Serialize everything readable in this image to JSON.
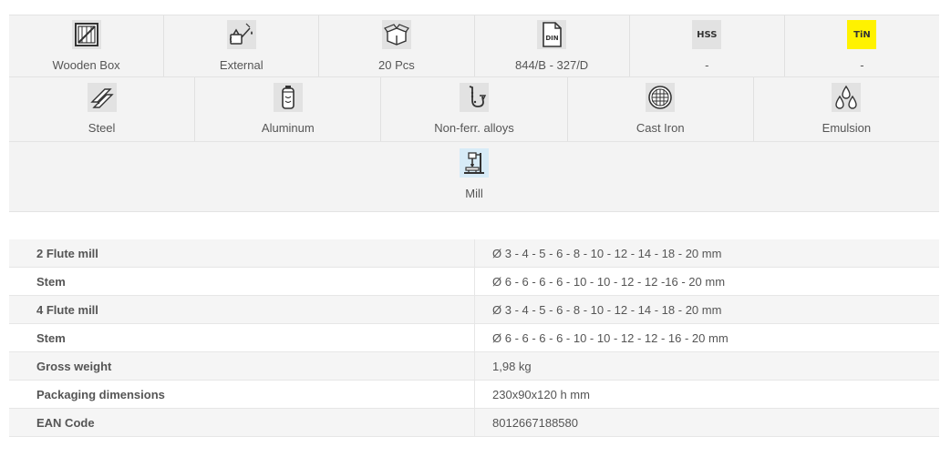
{
  "row1": [
    {
      "icon": "wooden-box-icon",
      "label": "Wooden Box"
    },
    {
      "icon": "oil-can-icon",
      "label": "External"
    },
    {
      "icon": "package-icon",
      "label": "20 Pcs"
    },
    {
      "icon": "din-document-icon",
      "label": "844/B - 327/D"
    },
    {
      "icon": "hss-badge-icon",
      "icon_text": "HSS",
      "label": "-"
    },
    {
      "icon": "tin-badge-icon",
      "icon_text": "TiN",
      "label": "-"
    }
  ],
  "row2": [
    {
      "icon": "steel-bars-icon",
      "label": "Steel"
    },
    {
      "icon": "aluminum-can-icon",
      "label": "Aluminum"
    },
    {
      "icon": "saxophone-icon",
      "label": "Non-ferr. alloys"
    },
    {
      "icon": "manhole-grate-icon",
      "label": "Cast Iron"
    },
    {
      "icon": "droplets-icon",
      "label": "Emulsion"
    }
  ],
  "row3": [
    {
      "icon": "milling-machine-icon",
      "label": "Mill"
    }
  ],
  "colors": {
    "tin_badge": "#fff200",
    "mill_badge": "#d7ebf7",
    "grey_badge": "#e2e2e2"
  },
  "specs": [
    {
      "key": "2 Flute mill",
      "value": "Ø 3 - 4 - 5 - 6 - 8 - 10 - 12 - 14 - 18 - 20 mm"
    },
    {
      "key": "Stem",
      "value": "Ø 6 - 6 - 6 - 6 - 10 - 10 - 12 - 12 -16 - 20 mm"
    },
    {
      "key": "4 Flute mill",
      "value": "Ø 3 - 4 - 5 - 6 - 8 - 10 - 12 - 14 - 18 - 20 mm"
    },
    {
      "key": "Stem",
      "value": "Ø 6 - 6 - 6 - 6 - 10 - 10 - 12 - 12 - 16 - 20 mm"
    },
    {
      "key": "Gross weight",
      "value": "1,98 kg"
    },
    {
      "key": "Packaging dimensions",
      "value": "230x90x120 h mm"
    },
    {
      "key": "EAN Code",
      "value": "8012667188580"
    }
  ]
}
